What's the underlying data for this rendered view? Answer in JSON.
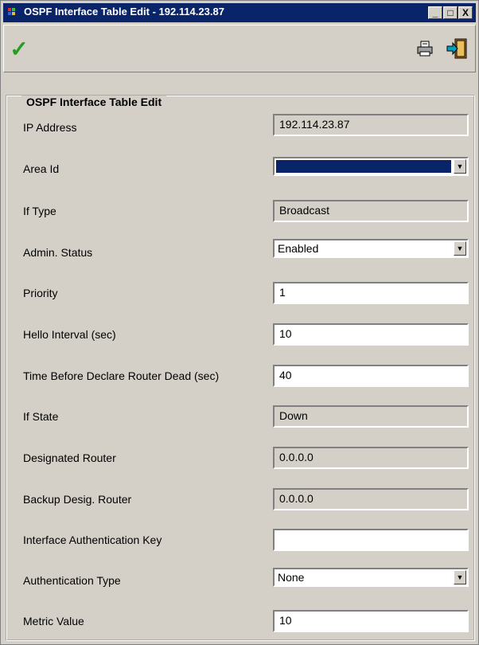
{
  "window": {
    "title": "OSPF Interface Table Edit - 192.114.23.87",
    "controls": {
      "minimize": "_",
      "maximize": "□",
      "close": "X"
    }
  },
  "toolbar": {
    "ok_icon": "checkmark-icon",
    "print_icon": "printer-icon",
    "exit_icon": "exit-door-icon"
  },
  "group": {
    "title": "OSPF Interface Table Edit",
    "fields": {
      "ip_address": {
        "label": "IP Address",
        "value": "192.114.23.87"
      },
      "area_id": {
        "label": "Area Id",
        "value": ""
      },
      "if_type": {
        "label": "If Type",
        "value": "Broadcast"
      },
      "admin_status": {
        "label": "Admin. Status",
        "value": "Enabled"
      },
      "priority": {
        "label": "Priority",
        "value": "1"
      },
      "hello_interval": {
        "label": "Hello Interval (sec)",
        "value": "10"
      },
      "dead_interval": {
        "label": "Time Before Declare Router Dead (sec)",
        "value": "40"
      },
      "if_state": {
        "label": "If State",
        "value": "Down"
      },
      "designated_router": {
        "label": "Designated Router",
        "value": "0.0.0.0"
      },
      "backup_router": {
        "label": "Backup Desig. Router",
        "value": "0.0.0.0"
      },
      "auth_key": {
        "label": "Interface Authentication Key",
        "value": ""
      },
      "auth_type": {
        "label": "Authentication Type",
        "value": "None"
      },
      "metric_value": {
        "label": "Metric Value",
        "value": "10"
      }
    }
  },
  "colors": {
    "titlebar": "#0a246a",
    "face": "#d4d0c8",
    "check": "#22a022"
  }
}
